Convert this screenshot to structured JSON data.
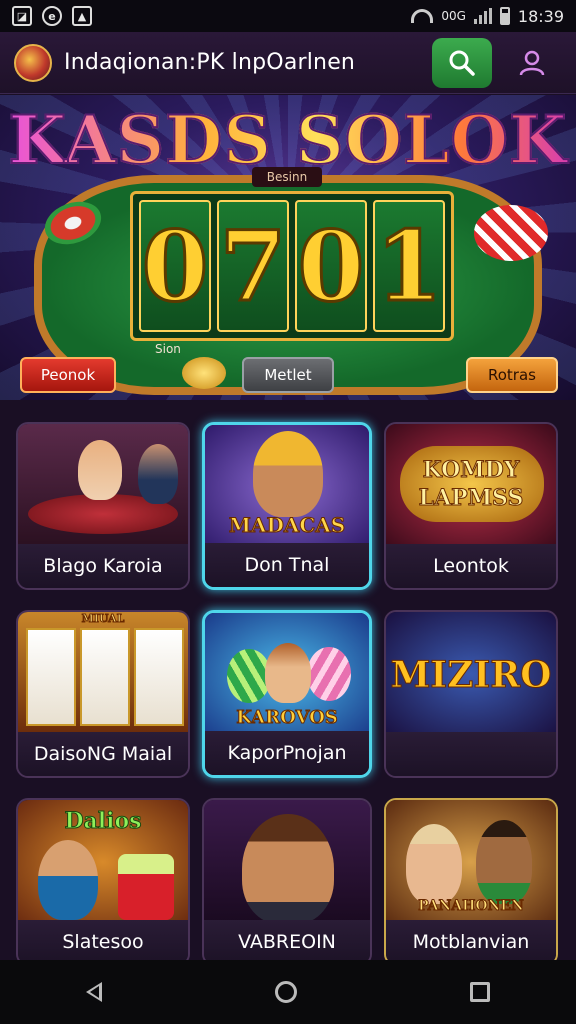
{
  "status_bar": {
    "left_icons": [
      "notification-icon",
      "app-icon",
      "store-icon"
    ],
    "signal_text": "00G",
    "time": "18:39"
  },
  "app_bar": {
    "title": "Indaqionan:PK lnpOarlnen"
  },
  "hero": {
    "title": "KASDS SOLOK",
    "table_label": "Besinn",
    "reels": [
      "0",
      "7",
      "0",
      "1"
    ],
    "caption": "Sion",
    "buttons": {
      "left": "Peonok",
      "center": "Metlet",
      "right": "Rotras"
    }
  },
  "games": [
    {
      "label": "Blago Karoia",
      "art_text": "",
      "glow": false
    },
    {
      "label": "Don Tnal",
      "art_text": "MADACAS",
      "glow": true
    },
    {
      "label": "Leontok",
      "art_text": "KOMDY LAPMSS",
      "glow": false
    },
    {
      "label": "DaisoNG Maial",
      "art_text": "MIUAL",
      "glow": false
    },
    {
      "label": "KaporPnojan",
      "art_text": "KAROVOS",
      "glow": true
    },
    {
      "label": "",
      "art_text": "MIZIRO",
      "glow": false
    },
    {
      "label": "Slatesoo",
      "art_text": "Dalios",
      "glow": false
    },
    {
      "label": "VABREOIN",
      "art_text": "",
      "glow": false
    },
    {
      "label": "Motblanvian",
      "art_text": "PANAHONEN",
      "glow": false
    }
  ],
  "nav": {
    "icons": [
      "back-icon",
      "home-icon",
      "recents-icon"
    ]
  }
}
